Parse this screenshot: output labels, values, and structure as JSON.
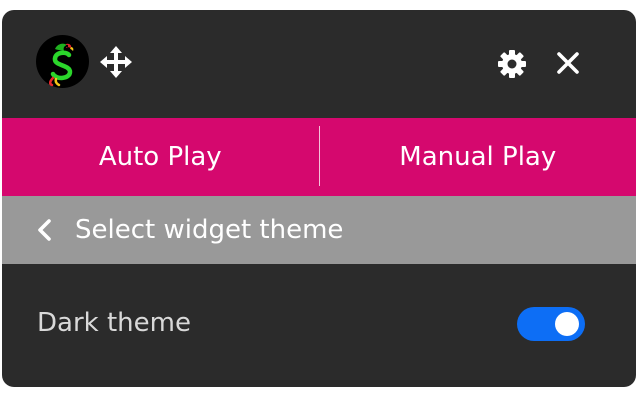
{
  "header": {
    "logo_letter": "S",
    "icons": [
      "parrot-s-logo",
      "move-icon",
      "gear-icon",
      "close-icon"
    ]
  },
  "tabs": [
    {
      "label": "Auto Play"
    },
    {
      "label": "Manual Play"
    }
  ],
  "subheader": {
    "title": "Select widget theme",
    "back_icon": "chevron-left-icon"
  },
  "settings": {
    "dark_theme_label": "Dark theme",
    "dark_theme_enabled": true
  },
  "colors": {
    "panel_bg": "#2b2b2b",
    "accent": "#d5086e",
    "subheader_bg": "#999999",
    "toggle_on": "#0d6ef5",
    "text": "#ffffff",
    "label_text": "#d9d9d9"
  }
}
